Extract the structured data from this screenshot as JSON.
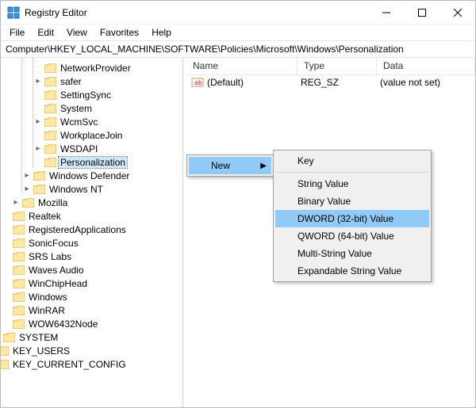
{
  "window": {
    "title": "Registry Editor"
  },
  "menu": {
    "file": "File",
    "edit": "Edit",
    "view": "View",
    "favorites": "Favorites",
    "help": "Help"
  },
  "address": "Computer\\HKEY_LOCAL_MACHINE\\SOFTWARE\\Policies\\Microsoft\\Windows\\Personalization",
  "columns": {
    "name": "Name",
    "type": "Type",
    "data": "Data"
  },
  "values": {
    "default": {
      "name": "(Default)",
      "type": "REG_SZ",
      "data": "(value not set)"
    }
  },
  "tree": {
    "n0": "NetworkProvider",
    "n1": "safer",
    "n2": "SettingSync",
    "n3": "System",
    "n4": "WcmSvc",
    "n5": "WorkplaceJoin",
    "n6": "WSDAPI",
    "n7": "Personalization",
    "n8": "Windows Defender",
    "n9": "Windows NT",
    "n10": "Mozilla",
    "n11": "Realtek",
    "n12": "RegisteredApplications",
    "n13": "SonicFocus",
    "n14": "SRS Labs",
    "n15": "Waves Audio",
    "n16": "WinChipHead",
    "n17": "Windows",
    "n18": "WinRAR",
    "n19": "WOW6432Node",
    "n20": "SYSTEM",
    "n21": "KEY_USERS",
    "n22": "KEY_CURRENT_CONFIG"
  },
  "context": {
    "new": "New",
    "sub": {
      "key": "Key",
      "string": "String Value",
      "binary": "Binary Value",
      "dword": "DWORD (32-bit) Value",
      "qword": "QWORD (64-bit) Value",
      "multi": "Multi-String Value",
      "expand": "Expandable String Value"
    }
  }
}
